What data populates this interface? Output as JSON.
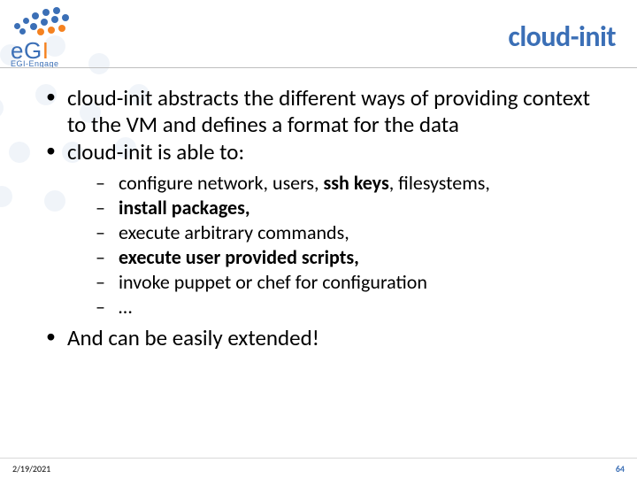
{
  "header": {
    "title": "cloud-init",
    "logo_primary": "eGI",
    "logo_sub": "EGI-Engage"
  },
  "bullets": {
    "b1": "cloud-init abstracts the different ways of providing context to the VM and defines a format for the data",
    "b2": "cloud-init is able to:",
    "sub1_pre": "configure network, users, ",
    "sub1_bold": "ssh keys",
    "sub1_post": ", filesystems,",
    "sub2": "install packages,",
    "sub3": "execute arbitrary commands,",
    "sub4": "execute user provided scripts,",
    "sub5": "invoke puppet or chef for configuration",
    "sub6": "…",
    "b3": "And can be easily extended!"
  },
  "footer": {
    "date": "2/19/2021",
    "page": "64"
  },
  "colors": {
    "accent": "#3b6fb6",
    "orange": "#f58220"
  }
}
